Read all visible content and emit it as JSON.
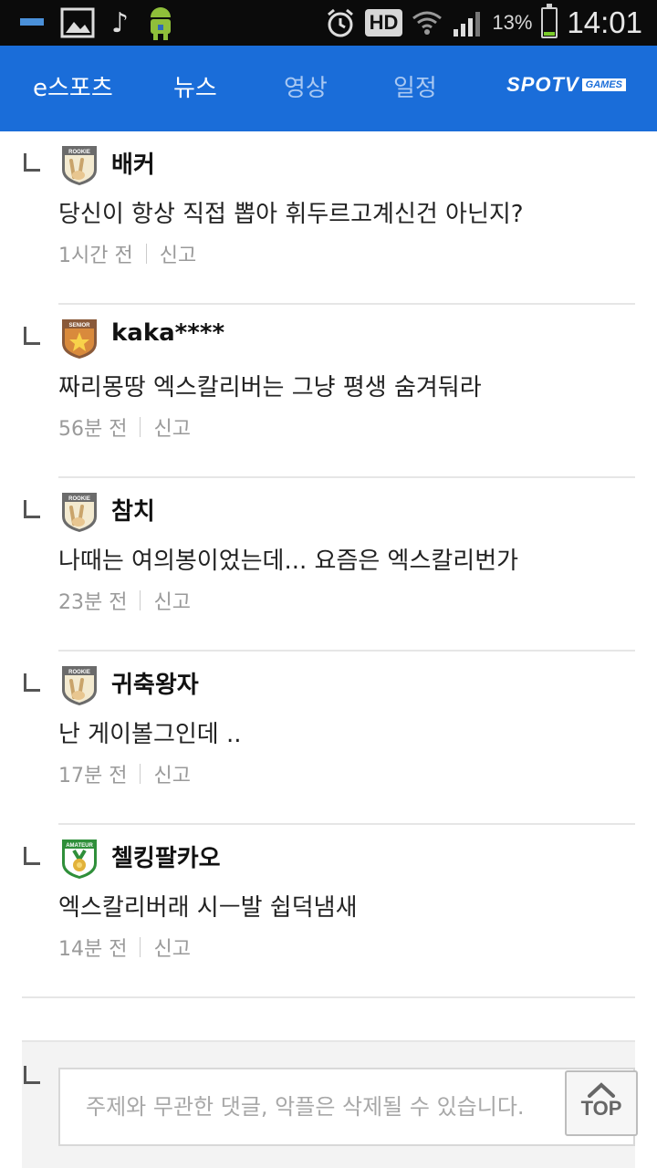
{
  "status_bar": {
    "battery_percent": "13%",
    "battery_level": 0.13,
    "time": "14:01",
    "hd_label": "HD",
    "icons": [
      "minus-icon",
      "image-icon",
      "music-note-icon",
      "android-icon",
      "alarm-icon",
      "wifi-icon",
      "signal-icon",
      "battery-icon"
    ]
  },
  "nav": {
    "tabs": [
      {
        "label": "e스포츠",
        "active": true
      },
      {
        "label": "뉴스",
        "active": true
      },
      {
        "label": "영상",
        "active": false
      },
      {
        "label": "일정",
        "active": false
      }
    ],
    "brand_main": "SPOTV",
    "brand_sub": "GAMES",
    "color": "#1a6dd9"
  },
  "comments": [
    {
      "badge": "ROOKIE",
      "author": "배커",
      "text": "당신이 항상 직접 뽑아 휘두르고계신건 아닌지?",
      "time": "1시간 전",
      "report": "신고"
    },
    {
      "badge": "SENIOR",
      "author": "kaka****",
      "text": "짜리몽땅 엑스칼리버는 그냥 평생 숨겨둬라",
      "time": "56분 전",
      "report": "신고"
    },
    {
      "badge": "ROOKIE",
      "author": "참치",
      "text": "나때는 여의봉이었는데... 요즘은 엑스칼리번가",
      "time": "23분 전",
      "report": "신고"
    },
    {
      "badge": "ROOKIE",
      "author": "귀축왕자",
      "text": "난 게이볼그인데 ..",
      "time": "17분 전",
      "report": "신고"
    },
    {
      "badge": "AMATEUR",
      "author": "첼킹팔카오",
      "text": "엑스칼리버래 시ㅡ발 쉽덕냄새",
      "time": "14분 전",
      "report": "신고"
    }
  ],
  "write": {
    "placeholder": "주제와 무관한 댓글, 악플은 삭제될 수 있습니다."
  },
  "top_button": {
    "label": "TOP"
  }
}
